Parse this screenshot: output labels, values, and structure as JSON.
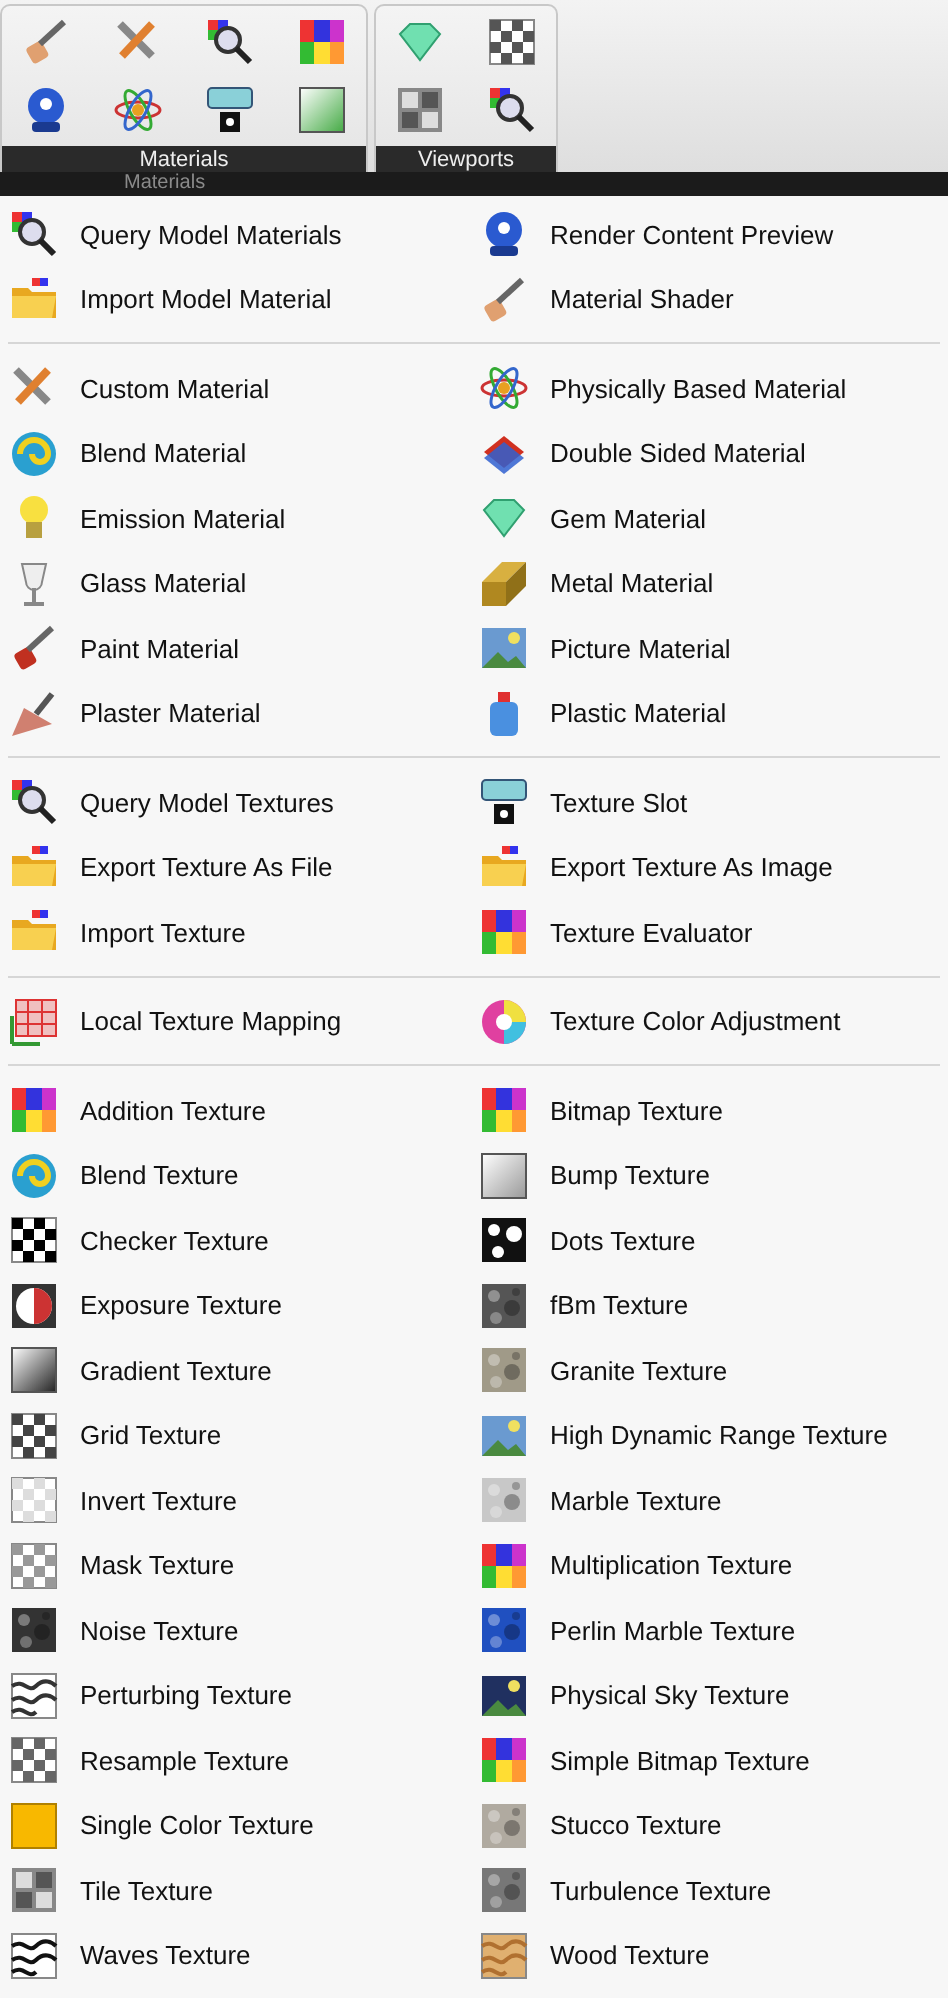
{
  "ribbon": {
    "panels": [
      {
        "title": "Materials"
      },
      {
        "title": "Viewports"
      }
    ]
  },
  "menu_header": {
    "reflection": "Materials"
  },
  "menu": {
    "sections": [
      {
        "items": [
          {
            "label": "Query Model Materials"
          },
          {
            "label": "Render Content Preview"
          },
          {
            "label": "Import Model Material"
          },
          {
            "label": "Material Shader"
          }
        ]
      },
      {
        "items": [
          {
            "label": "Custom Material"
          },
          {
            "label": "Physically Based Material"
          },
          {
            "label": "Blend Material"
          },
          {
            "label": "Double Sided Material"
          },
          {
            "label": "Emission Material"
          },
          {
            "label": "Gem Material"
          },
          {
            "label": "Glass Material"
          },
          {
            "label": "Metal Material"
          },
          {
            "label": "Paint Material"
          },
          {
            "label": "Picture Material"
          },
          {
            "label": "Plaster Material"
          },
          {
            "label": "Plastic Material"
          }
        ]
      },
      {
        "items": [
          {
            "label": "Query Model Textures"
          },
          {
            "label": "Texture Slot"
          },
          {
            "label": "Export Texture As File"
          },
          {
            "label": "Export Texture As Image"
          },
          {
            "label": "Import Texture"
          },
          {
            "label": "Texture Evaluator"
          }
        ]
      },
      {
        "items": [
          {
            "label": "Local Texture Mapping"
          },
          {
            "label": "Texture Color Adjustment"
          }
        ]
      },
      {
        "items": [
          {
            "label": "Addition Texture"
          },
          {
            "label": "Bitmap Texture"
          },
          {
            "label": "Blend Texture"
          },
          {
            "label": "Bump Texture"
          },
          {
            "label": "Checker Texture"
          },
          {
            "label": "Dots Texture"
          },
          {
            "label": "Exposure Texture"
          },
          {
            "label": "fBm Texture"
          },
          {
            "label": "Gradient Texture"
          },
          {
            "label": "Granite Texture"
          },
          {
            "label": "Grid Texture"
          },
          {
            "label": "High Dynamic Range Texture"
          },
          {
            "label": "Invert Texture"
          },
          {
            "label": "Marble Texture"
          },
          {
            "label": "Mask Texture"
          },
          {
            "label": "Multiplication Texture"
          },
          {
            "label": "Noise Texture"
          },
          {
            "label": "Perlin Marble Texture"
          },
          {
            "label": "Perturbing Texture"
          },
          {
            "label": "Physical Sky Texture"
          },
          {
            "label": "Resample Texture"
          },
          {
            "label": "Simple Bitmap Texture"
          },
          {
            "label": "Single Color Texture"
          },
          {
            "label": "Stucco Texture"
          },
          {
            "label": "Tile Texture"
          },
          {
            "label": "Turbulence Texture"
          },
          {
            "label": "Waves Texture"
          },
          {
            "label": "Wood Texture"
          }
        ]
      }
    ]
  }
}
